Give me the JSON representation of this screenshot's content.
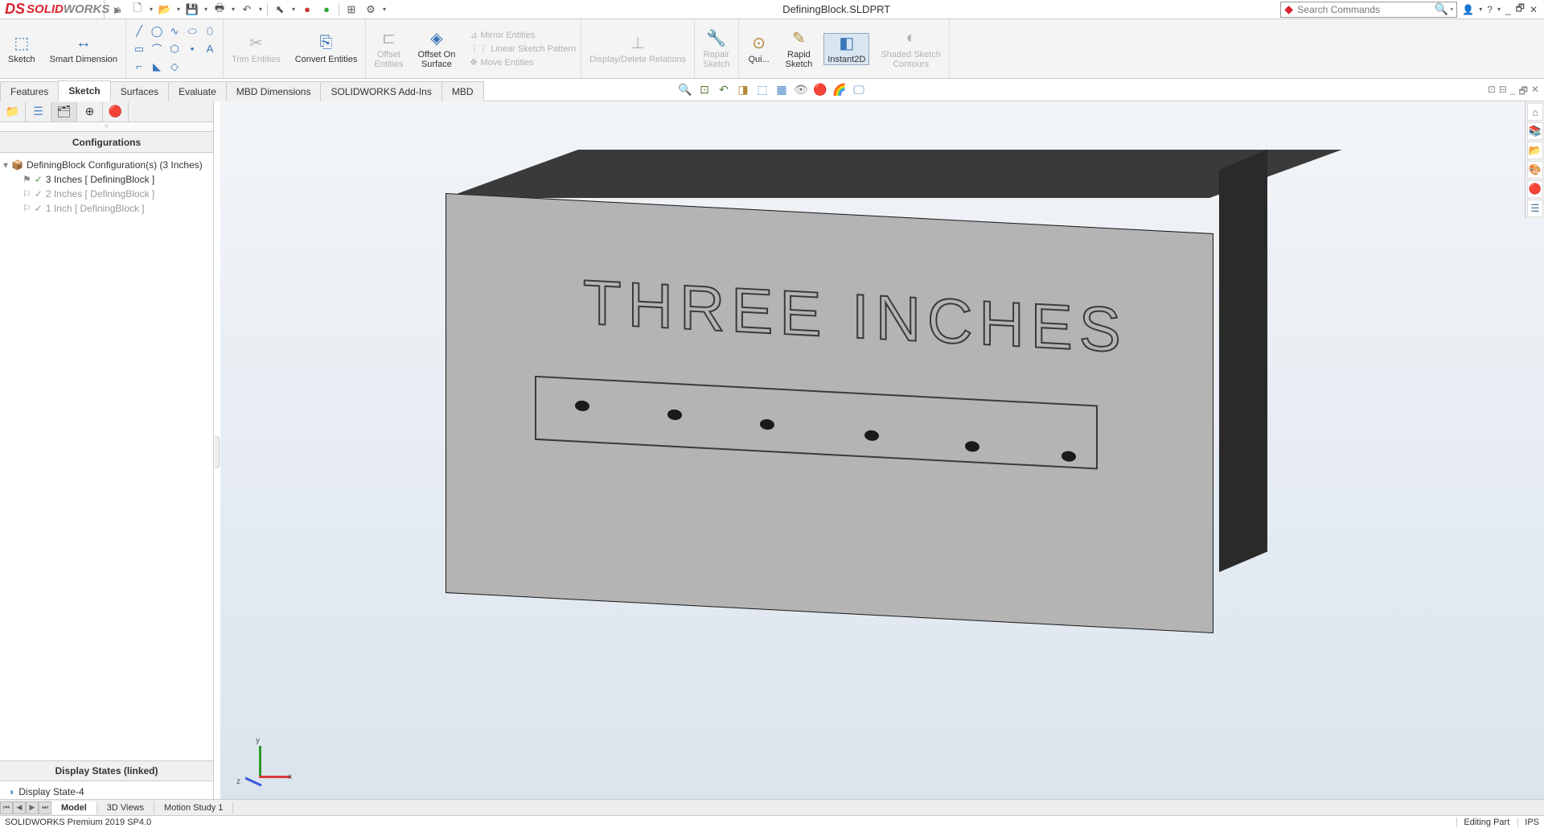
{
  "app": {
    "brand_ds": "DS",
    "brand_solid": "SOLID",
    "brand_works": "WORKS",
    "document_title": "DefiningBlock.SLDPRT",
    "search_placeholder": "Search Commands"
  },
  "ribbon": {
    "sketch": "Sketch",
    "smart_dim": "Smart Dimension",
    "trim": "Trim Entities",
    "convert": "Convert Entities",
    "offset": "Offset\nEntities",
    "offset_surface": "Offset On\nSurface",
    "mirror": "Mirror Entities",
    "linear_pattern": "Linear Sketch Pattern",
    "move": "Move Entities",
    "display_del": "Display/Delete Relations",
    "repair": "Repair\nSketch",
    "quick": "Qui...",
    "rapid": "Rapid\nSketch",
    "instant2d": "Instant2D",
    "shaded": "Shaded Sketch\nContours"
  },
  "tabs": {
    "features": "Features",
    "sketch": "Sketch",
    "surfaces": "Surfaces",
    "evaluate": "Evaluate",
    "mbd_dim": "MBD Dimensions",
    "addins": "SOLIDWORKS Add-Ins",
    "mbd": "MBD"
  },
  "panel": {
    "header": "Configurations",
    "root": "DefiningBlock Configuration(s)  (3 Inches)",
    "items": [
      {
        "label": "3 Inches [ DefiningBlock ]",
        "active": true
      },
      {
        "label": "2 Inches [ DefiningBlock ]",
        "active": false
      },
      {
        "label": "1 Inch [ DefiningBlock ]",
        "active": false
      }
    ],
    "display_states_header": "Display States (linked)",
    "display_state": "Display State-4"
  },
  "model": {
    "engraved_text": "THREE INCHES"
  },
  "triad": {
    "x": "x",
    "y": "y",
    "z": "z"
  },
  "bottom": {
    "model": "Model",
    "views3d": "3D Views",
    "motion": "Motion Study 1"
  },
  "status": {
    "left": "SOLIDWORKS Premium 2019 SP4.0",
    "editing": "Editing Part",
    "units": "IPS"
  }
}
